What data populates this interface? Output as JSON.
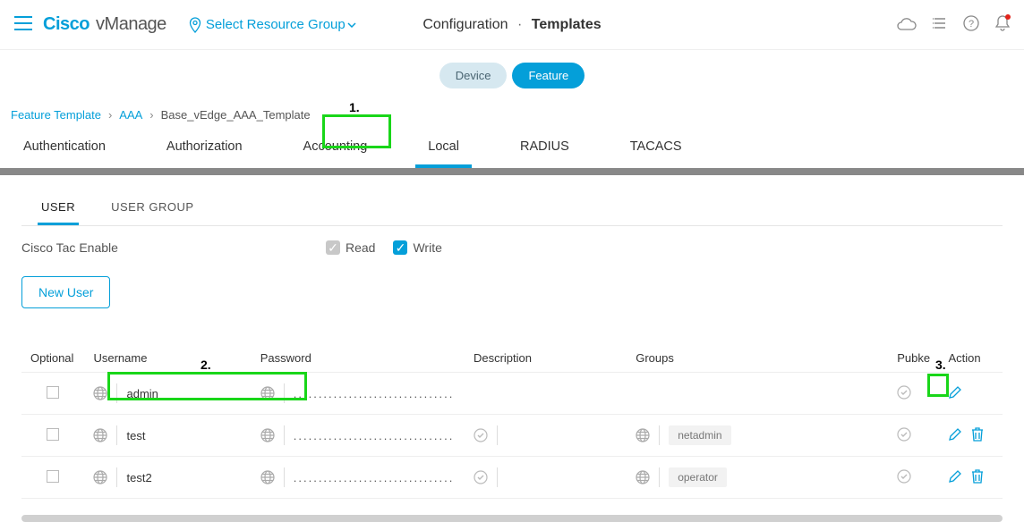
{
  "header": {
    "brand_main": "Cisco",
    "brand_sub": "vManage",
    "resource_group": "Select Resource Group",
    "page_section": "Configuration",
    "page_subsection": "Templates"
  },
  "pills": {
    "device": "Device",
    "feature": "Feature"
  },
  "breadcrumb": {
    "a": "Feature Template",
    "b": "AAA",
    "c": "Base_vEdge_AAA_Template"
  },
  "callouts": {
    "one": "1.",
    "two": "2.",
    "three": "3."
  },
  "main_tabs": [
    "Authentication",
    "Authorization",
    "Accounting",
    "Local",
    "RADIUS",
    "TACACS"
  ],
  "sub_tabs": [
    "USER",
    "USER GROUP"
  ],
  "tac": {
    "label": "Cisco Tac Enable",
    "read": "Read",
    "write": "Write"
  },
  "buttons": {
    "new_user": "New User"
  },
  "table": {
    "cols": {
      "optional": "Optional",
      "username": "Username",
      "password": "Password",
      "description": "Description",
      "groups": "Groups",
      "pubkey": "Pubke",
      "action": "Action"
    },
    "rows": [
      {
        "username": "admin",
        "password": "................................",
        "description": "",
        "groups": "",
        "show_desc_tick": false,
        "show_groups_globe": false,
        "show_trash": false
      },
      {
        "username": "test",
        "password": "................................",
        "description": "",
        "groups": "netadmin",
        "show_desc_tick": true,
        "show_groups_globe": true,
        "show_trash": true
      },
      {
        "username": "test2",
        "password": "................................",
        "description": "",
        "groups": "operator",
        "show_desc_tick": true,
        "show_groups_globe": true,
        "show_trash": true
      }
    ]
  }
}
